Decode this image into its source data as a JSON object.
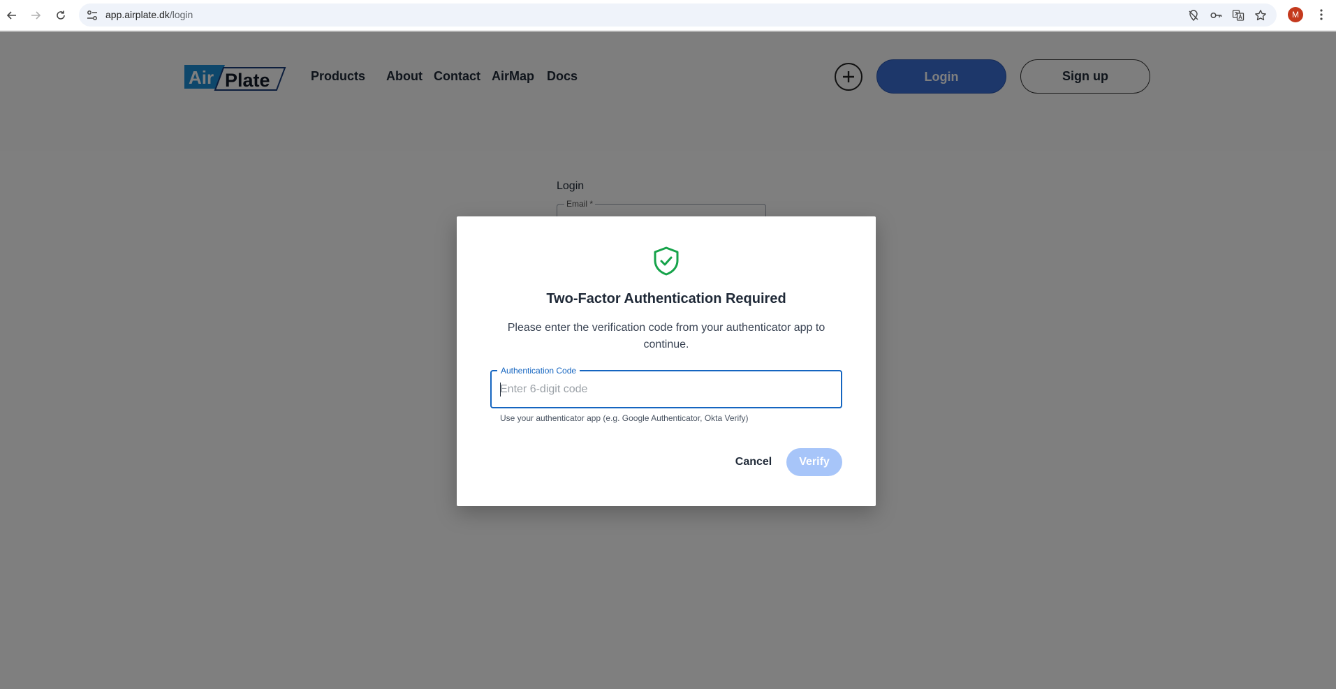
{
  "browser": {
    "url_host": "app.airplate.dk",
    "url_path": "/login",
    "profile_initial": "M"
  },
  "site": {
    "logo_left": "Air",
    "logo_right": "Plate",
    "nav": {
      "products": "Products",
      "about": "About",
      "contact": "Contact",
      "airmap": "AirMap",
      "docs": "Docs"
    },
    "login_button": "Login",
    "signup_button": "Sign up"
  },
  "login_form": {
    "title": "Login",
    "email_label": "Email *"
  },
  "modal": {
    "title": "Two-Factor Authentication Required",
    "description": "Please enter the verification code from your authenticator app to continue.",
    "code_label": "Authentication Code",
    "code_placeholder": "Enter 6-digit code",
    "code_value": "",
    "helper_text": "Use your authenticator app (e.g. Google Authenticator, Okta Verify)",
    "cancel_label": "Cancel",
    "verify_label": "Verify"
  },
  "colors": {
    "accent": "#1565c0",
    "shield": "#16a34a",
    "verify_disabled": "#a7c5f9",
    "login_button": "#3b6fd4",
    "avatar": "#c4391d"
  }
}
